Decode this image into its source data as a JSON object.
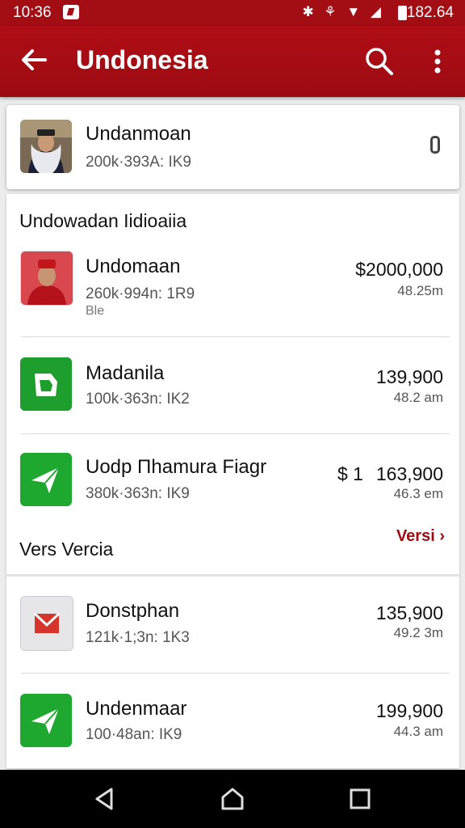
{
  "status_bar": {
    "time": "10:36",
    "icons": "✱ ⚘ ▼ ◢",
    "battery_level": "182.64"
  },
  "app_bar": {
    "title": "Undonesia",
    "back_icon": "arrow-left-icon",
    "search_icon": "search-icon",
    "more_icon": "more-vert-icon"
  },
  "top_card": {
    "name": "Undanmoan",
    "meta": "200k·393A: IK9"
  },
  "section1": {
    "title": "Undowadan Iidioaiia"
  },
  "list1": [
    {
      "name": "Undomaan",
      "meta": "260k·994n: 1R9",
      "extra": "Ble",
      "price": "$2000,000",
      "sub": "48.25m"
    },
    {
      "name": "Madanila",
      "meta": "100k·363n: IK2",
      "price": "139,900",
      "sub": "48.2 am"
    },
    {
      "name": "Uodp Πhamura Fiagr",
      "meta": "380k·363n: IK9",
      "price_prefix": "$ 1",
      "price": "163,900",
      "sub": "46.3 em"
    }
  ],
  "section2": {
    "title": "Vers Vercia",
    "link": "Versi"
  },
  "list2": [
    {
      "name": "Donstphan",
      "meta": "121k·1;3n: 1K3",
      "price": "135,900",
      "sub": "49.2 3m"
    },
    {
      "name": "Undenmaar",
      "meta": "100·48an: IK9",
      "price": "199,900",
      "sub": "44.3 am"
    }
  ],
  "colors": {
    "primary": "#a30d14",
    "green": "#1e9e2d",
    "accent_text": "#9e0d14"
  }
}
